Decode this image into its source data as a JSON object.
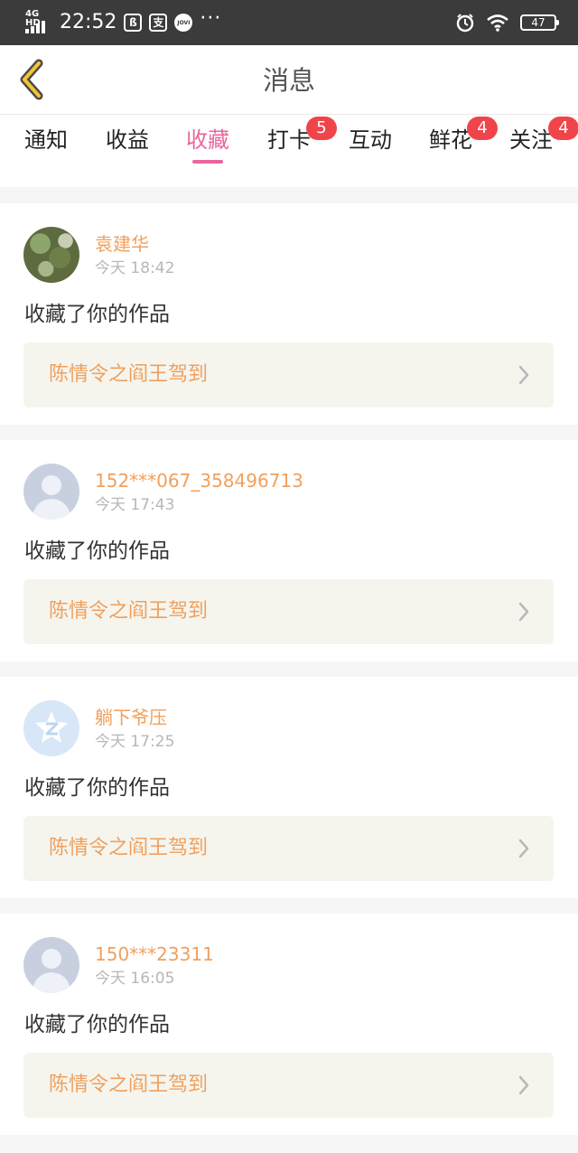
{
  "status_bar": {
    "network": "4G HD",
    "time": "22:52",
    "app_icon_1": "ß",
    "app_icon_2": "支",
    "app_icon_3": "JOVI",
    "more": "···",
    "battery": "47",
    "icons": [
      "signal-icon",
      "alarm-icon",
      "wifi-icon",
      "battery-icon"
    ]
  },
  "header": {
    "title": "消息",
    "back_icon": "chevron-left-icon"
  },
  "tabs": [
    {
      "label": "通知",
      "badge": ""
    },
    {
      "label": "收益",
      "badge": ""
    },
    {
      "label": "收藏",
      "badge": "",
      "active": true
    },
    {
      "label": "打卡",
      "badge": "5"
    },
    {
      "label": "互动",
      "badge": ""
    },
    {
      "label": "鲜花",
      "badge": "4"
    },
    {
      "label": "关注",
      "badge": "4"
    }
  ],
  "colors": {
    "accent": "#e8669d",
    "name": "#f0a05d",
    "badge": "#f0444b",
    "status_bar": "#3b3b3b"
  },
  "notifications": [
    {
      "name": "袁建华",
      "time": "今天 18:42",
      "action": "收藏了你的作品",
      "work": "陈情令之阎王驾到",
      "avatar": "photo"
    },
    {
      "name": "152***067_358496713",
      "time": "今天 17:43",
      "action": "收藏了你的作品",
      "work": "陈情令之阎王驾到",
      "avatar": "default-user-icon"
    },
    {
      "name": "躺下爷压",
      "time": "今天 17:25",
      "action": "收藏了你的作品",
      "work": "陈情令之阎王驾到",
      "avatar": "qq-logo-icon"
    },
    {
      "name": "150***23311",
      "time": "今天 16:05",
      "action": "收藏了你的作品",
      "work": "陈情令之阎王驾到",
      "avatar": "default-user-icon"
    }
  ]
}
